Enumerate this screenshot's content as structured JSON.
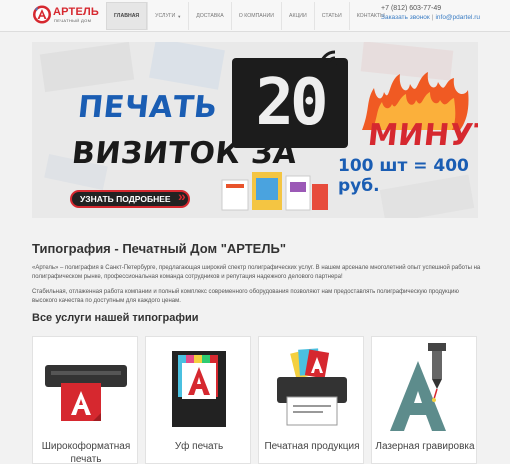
{
  "header": {
    "logo": {
      "title": "АРТЕЛЬ",
      "subtitle": "ПЕЧАТНЫЙ ДОМ"
    },
    "nav": [
      {
        "label": "ГЛАВНАЯ",
        "active": true
      },
      {
        "label": "УСЛУГИ",
        "has_dropdown": true
      },
      {
        "label": "ДОСТАВКА"
      },
      {
        "label": "О КОМПАНИИ"
      },
      {
        "label": "АКЦИИ"
      },
      {
        "label": "СТАТЬИ"
      },
      {
        "label": "КОНТАКТЫ"
      }
    ],
    "contacts": {
      "phone": "+7 (812) 603-77-49",
      "callback": "Заказать звонок",
      "separator": "|",
      "email": "info@pdartel.ru"
    }
  },
  "banner": {
    "line1": "ПЕЧАТЬ",
    "line2": "ВИЗИТОК ЗА",
    "number": "20",
    "unit": "МИНУТ",
    "price": "100 шт = 400 руб.",
    "cta": "УЗНАТЬ ПОДРОБНЕЕ",
    "colors": {
      "blue": "#1a5db3",
      "red": "#d6282f",
      "dark": "#1c1c1c"
    }
  },
  "about": {
    "title": "Типография - Печатный Дом \"АРТЕЛЬ\"",
    "p1": "«Артель» – полиграфия в Санкт-Петербурге, предлагающая широкий спектр полиграфических услуг. В нашем арсенале многолетний опыт успешной работы на полиграфическом рынке, профессиональная команда сотрудников и репутация надежного делового партнера!",
    "p2": "Стабильная, отлаженная работа компании и полный комплекс современного оборудования позволяют нам предоставлять полиграфическую продукцию высокого качества по доступным для каждого ценам."
  },
  "services": {
    "title": "Все услуги нашей типографии",
    "items": [
      {
        "label": "Широкоформатная печать",
        "icon": "wide-format-printer-icon"
      },
      {
        "label": "Уф печать",
        "icon": "uv-print-icon"
      },
      {
        "label": "Печатная продукция",
        "icon": "printer-icon"
      },
      {
        "label": "Лазерная гравировка",
        "icon": "laser-engraving-icon"
      }
    ]
  }
}
